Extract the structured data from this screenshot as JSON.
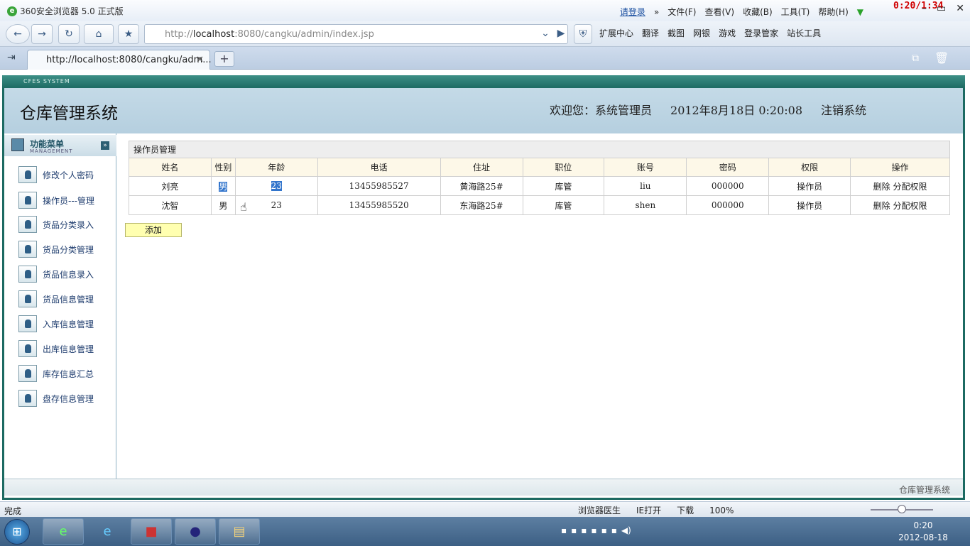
{
  "browser": {
    "title": "360安全浏览器 5.0 正式版",
    "menu": {
      "login": "请登录",
      "file": "文件(F)",
      "view": "查看(V)",
      "favorites": "收藏(B)",
      "tools": "工具(T)",
      "help": "帮助(H)"
    },
    "overlay_clock": "0:20/1:34",
    "url_prefix": "http://",
    "url_host": "localhost",
    "url_rest": ":8080/cangku/admin/index.jsp",
    "toolbar": {
      "extensions": "扩展中心",
      "translate": "翻译",
      "screenshot": "截图",
      "bank": "网银",
      "games": "游戏",
      "password_manager": "登录管家",
      "webmaster": "站长工具"
    },
    "tab_title": "http://localhost:8080/cangku/adm...",
    "status": "完成",
    "status_right": {
      "doctor": "浏览器医生",
      "ie_open": "IE打开",
      "download": "下载",
      "zoom": "100%"
    }
  },
  "app": {
    "system_label": "CFES SYSTEM",
    "title": "仓库管理系统",
    "welcome": "欢迎您：系统管理员",
    "datetime": "2012年8月18日  0:20:08",
    "logout": "注销系统",
    "footer": "仓库管理系统"
  },
  "sidebar": {
    "heading": "功能菜单",
    "subheading": "MANAGEMENT",
    "items": [
      {
        "label": "修改个人密码"
      },
      {
        "label": "操作员---管理"
      },
      {
        "label": "货品分类录入"
      },
      {
        "label": "货品分类管理"
      },
      {
        "label": "货品信息录入"
      },
      {
        "label": "货品信息管理"
      },
      {
        "label": "入库信息管理"
      },
      {
        "label": "出库信息管理"
      },
      {
        "label": "库存信息汇总"
      },
      {
        "label": "盘存信息管理"
      }
    ]
  },
  "table": {
    "caption": "操作员管理",
    "headers": [
      "姓名",
      "性别",
      "年龄",
      "电话",
      "住址",
      "职位",
      "账号",
      "密码",
      "权限",
      "操作"
    ],
    "rows": [
      {
        "name": "刘亮",
        "gender": "男",
        "age": "23",
        "phone": "13455985527",
        "address": "黄海路25#",
        "position": "库管",
        "account": "liu",
        "password": "000000",
        "role": "操作员",
        "delete": "删除",
        "assign": "分配权限"
      },
      {
        "name": "沈智",
        "gender": "男",
        "age": "23",
        "phone": "13455985520",
        "address": "东海路25#",
        "position": "库管",
        "account": "shen",
        "password": "000000",
        "role": "操作员",
        "delete": "删除",
        "assign": "分配权限"
      }
    ],
    "add_label": "添加"
  },
  "taskbar": {
    "clock_time": "0:20",
    "clock_date": "2012-08-18"
  }
}
